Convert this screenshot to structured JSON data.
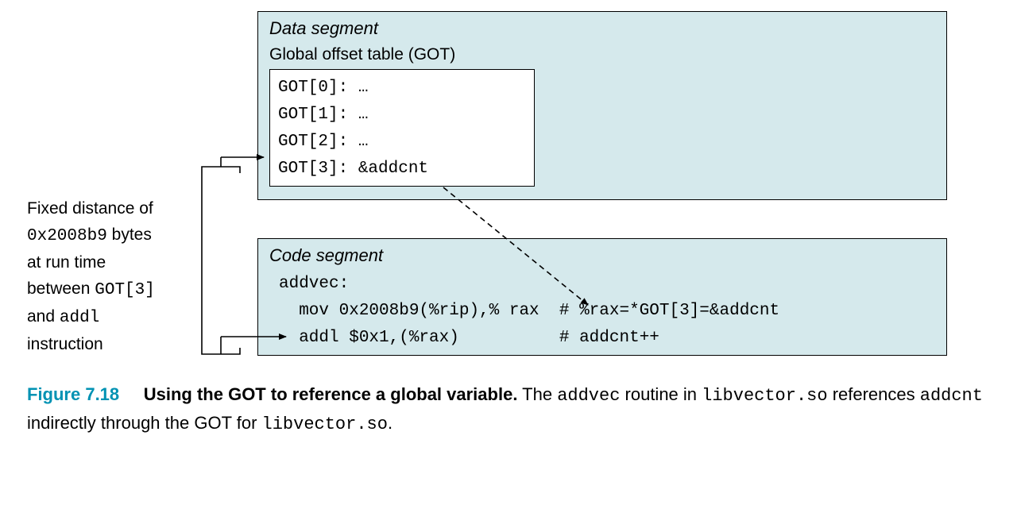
{
  "annotation": {
    "line1": "Fixed distance of",
    "line2_a": "0x2008b9",
    "line2_b": " bytes",
    "line3": "at run time",
    "line4_a": "between ",
    "line4_b": "GOT[3]",
    "line5_a": "and ",
    "line5_b": "addl",
    "line6": "instruction"
  },
  "data_segment": {
    "title": "Data segment",
    "got_title": "Global offset table (GOT)",
    "entries": [
      "GOT[0]: …",
      "GOT[1]: …",
      "GOT[2]: …",
      "GOT[3]: &addcnt"
    ]
  },
  "code_segment": {
    "title": "Code segment",
    "label": "addvec:",
    "line1_instr": "  mov 0x2008b9(%rip),% rax",
    "line1_comment": "  # %rax=*GOT[3]=&addcnt",
    "line2_instr": "  addl $0x1,(%rax)",
    "line2_padding": "          ",
    "line2_comment": "# addcnt++"
  },
  "caption": {
    "figure_label": "Figure 7.18",
    "title": "Using the GOT to reference a global variable.",
    "text_a": " The ",
    "text_b": "addvec",
    "text_c": " routine in ",
    "text_d": "libvector.so",
    "text_e": " references ",
    "text_f": "addcnt",
    "text_g": " indirectly through the GOT for ",
    "text_h": "libvector.so",
    "text_i": "."
  }
}
